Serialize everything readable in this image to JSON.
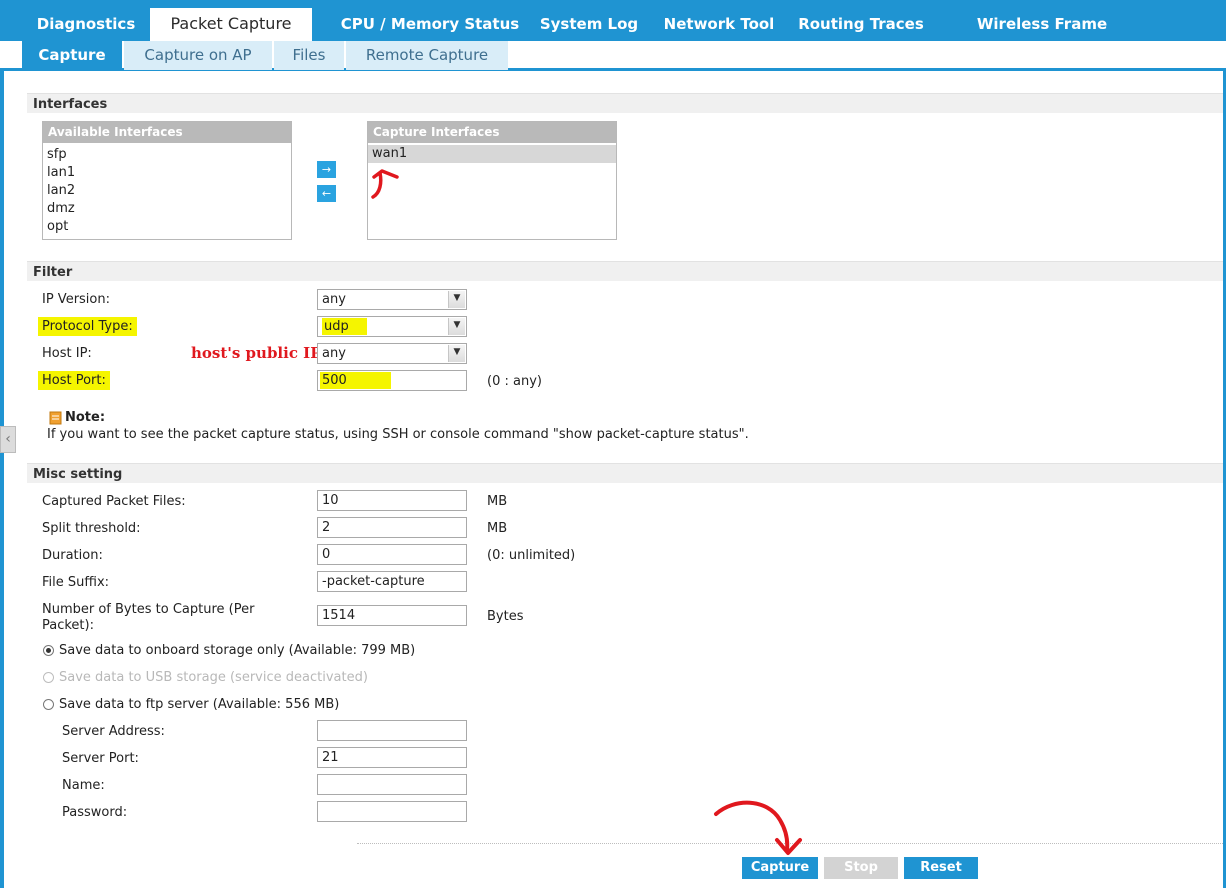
{
  "top_tabs": [
    "Diagnostics",
    "Packet Capture",
    "CPU / Memory Status",
    "System Log",
    "Network Tool",
    "Routing Traces",
    "Wireless Frame Capture"
  ],
  "sub_tabs": [
    "Capture",
    "Capture on AP",
    "Files",
    "Remote Capture"
  ],
  "interfaces": {
    "title": "Interfaces",
    "available_header": "Available Interfaces",
    "available": [
      "sfp",
      "lan1",
      "lan2",
      "dmz",
      "opt"
    ],
    "capture_header": "Capture Interfaces",
    "capture": [
      "wan1"
    ],
    "add_arrow": "→",
    "remove_arrow": "←"
  },
  "filter": {
    "title": "Filter",
    "ip_version_label": "IP Version:",
    "ip_version_value": "any",
    "protocol_label": "Protocol Type:",
    "protocol_value": "udp",
    "host_ip_label": "Host IP:",
    "host_ip_value": "any",
    "host_port_label": "Host Port:",
    "host_port_value": "500",
    "host_port_hint": "(0 : any)",
    "note_title": "Note:",
    "note_text": "If you want to see the packet capture status, using SSH or console command \"show packet-capture status\"."
  },
  "annotation": "host's public IP",
  "misc": {
    "title": "Misc setting",
    "packet_files_label": "Captured Packet Files:",
    "packet_files_value": "10",
    "packet_files_unit": "MB",
    "split_label": "Split threshold:",
    "split_value": "2",
    "split_unit": "MB",
    "duration_label": "Duration:",
    "duration_value": "0",
    "duration_hint": "(0: unlimited)",
    "suffix_label": "File Suffix:",
    "suffix_value": "-packet-capture",
    "bytes_label_1": "Number of Bytes to Capture (Per",
    "bytes_label_2": "Packet):",
    "bytes_value": "1514",
    "bytes_unit": "Bytes",
    "radio_onboard": "Save data to onboard storage only (Available: 799 MB)",
    "radio_usb": "Save data to USB storage (service deactivated)",
    "radio_ftp": "Save data to ftp server (Available: 556 MB)",
    "server_address_label": "Server Address:",
    "server_address_value": "",
    "server_port_label": "Server Port:",
    "server_port_value": "21",
    "name_label": "Name:",
    "name_value": "",
    "password_label": "Password:",
    "password_value": ""
  },
  "buttons": {
    "capture": "Capture",
    "stop": "Stop",
    "reset": "Reset"
  },
  "colors": {
    "accent": "#1f94d2",
    "highlight": "#f5f500",
    "annotation": "#e0181e"
  }
}
